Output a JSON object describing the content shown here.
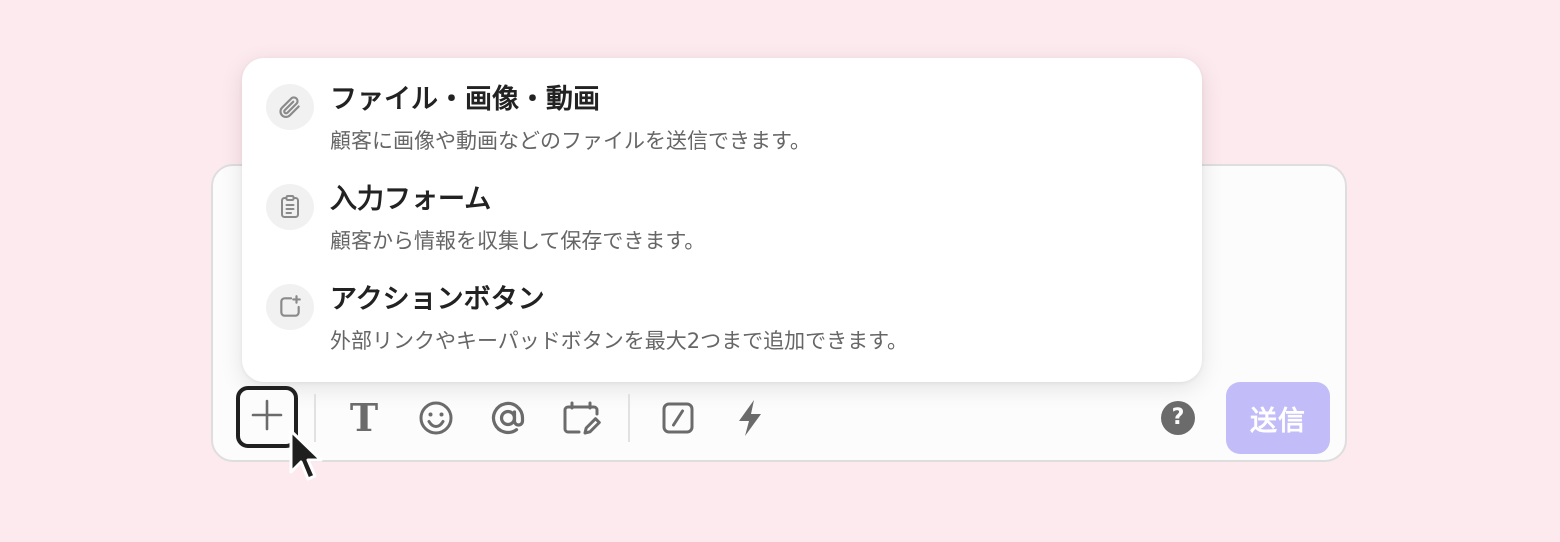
{
  "menu": {
    "items": [
      {
        "icon": "paperclip-icon",
        "title": "ファイル・画像・動画",
        "description": "顧客に画像や動画などのファイルを送信できます。"
      },
      {
        "icon": "clipboard-icon",
        "title": "入力フォーム",
        "description": "顧客から情報を収集して保存できます。"
      },
      {
        "icon": "square-plus-icon",
        "title": "アクションボタン",
        "description": "外部リンクやキーパッドボタンを最大2つまで追加できます。"
      }
    ]
  },
  "toolbar": {
    "text_format_glyph": "T",
    "help_glyph": "?",
    "send_label": "送信"
  },
  "colors": {
    "background": "#fdeaee",
    "send_button": "#c2bdf8",
    "icon_gray": "#6b6b6b"
  }
}
